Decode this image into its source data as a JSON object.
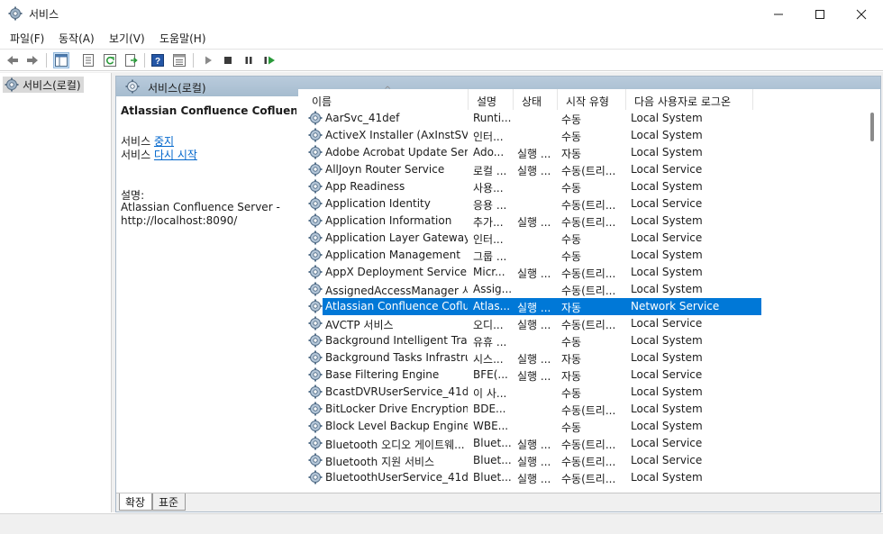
{
  "window": {
    "title": "서비스",
    "icon": "gear-icon"
  },
  "menu": [
    {
      "label": "파일(F)"
    },
    {
      "label": "동작(A)"
    },
    {
      "label": "보기(V)"
    },
    {
      "label": "도움말(H)"
    }
  ],
  "toolbar": {
    "buttons": [
      "back-icon",
      "forward-icon",
      "console-tree-icon",
      "properties-icon",
      "refresh-icon",
      "export-icon",
      "help-icon",
      "details-view-icon",
      "play-icon",
      "stop-icon",
      "pause-icon",
      "resume-icon"
    ]
  },
  "tree": {
    "item_label": "서비스(로컬)"
  },
  "pane": {
    "title": "서비스(로컬)"
  },
  "details": {
    "title": "Atlassian Confluence Cofluence",
    "action_prefix_1": "서비스 ",
    "stop_link": "중지",
    "action_prefix_2": "서비스 ",
    "restart_link": "다시 시작",
    "desc_label": "설명:",
    "desc_line1": "Atlassian Confluence Server -",
    "desc_line2": "http://localhost:8090/"
  },
  "columns": {
    "name": "이름",
    "description": "설명",
    "status": "상태",
    "startup": "시작 유형",
    "logon": "다음 사용자로 로그온"
  },
  "services": [
    {
      "name": "AarSvc_41def",
      "description": "Runti...",
      "status": "",
      "startup": "수동",
      "logon": "Local System"
    },
    {
      "name": "ActiveX Installer (AxInstSV)",
      "description": "인터...",
      "status": "",
      "startup": "수동",
      "logon": "Local System"
    },
    {
      "name": "Adobe Acrobat Update Ser...",
      "description": "Ado...",
      "status": "실행 ...",
      "startup": "자동",
      "logon": "Local System"
    },
    {
      "name": "AllJoyn Router Service",
      "description": "로컬 ...",
      "status": "실행 ...",
      "startup": "수동(트리...",
      "logon": "Local Service"
    },
    {
      "name": "App Readiness",
      "description": "사용...",
      "status": "",
      "startup": "수동",
      "logon": "Local System"
    },
    {
      "name": "Application Identity",
      "description": "응용 ...",
      "status": "",
      "startup": "수동(트리...",
      "logon": "Local Service"
    },
    {
      "name": "Application Information",
      "description": "추가...",
      "status": "실행 ...",
      "startup": "수동(트리...",
      "logon": "Local System"
    },
    {
      "name": "Application Layer Gateway ...",
      "description": "인터...",
      "status": "",
      "startup": "수동",
      "logon": "Local Service"
    },
    {
      "name": "Application Management",
      "description": "그룹 ...",
      "status": "",
      "startup": "수동",
      "logon": "Local System"
    },
    {
      "name": "AppX Deployment Service ...",
      "description": "Micr...",
      "status": "실행 ...",
      "startup": "수동(트리...",
      "logon": "Local System"
    },
    {
      "name": "AssignedAccessManager 서...",
      "description": "Assig...",
      "status": "",
      "startup": "수동(트리...",
      "logon": "Local System"
    },
    {
      "name": "Atlassian Confluence Coflu...",
      "description": "Atlas...",
      "status": "실행 ...",
      "startup": "자동",
      "logon": "Network Service",
      "selected": true
    },
    {
      "name": "AVCTP 서비스",
      "description": "오디...",
      "status": "실행 ...",
      "startup": "수동(트리...",
      "logon": "Local Service"
    },
    {
      "name": "Background Intelligent Tra...",
      "description": "유휴 ...",
      "status": "",
      "startup": "수동",
      "logon": "Local System"
    },
    {
      "name": "Background Tasks Infrastru...",
      "description": "시스...",
      "status": "실행 ...",
      "startup": "자동",
      "logon": "Local System"
    },
    {
      "name": "Base Filtering Engine",
      "description": "BFE(...",
      "status": "실행 ...",
      "startup": "자동",
      "logon": "Local Service"
    },
    {
      "name": "BcastDVRUserService_41def",
      "description": "이 사...",
      "status": "",
      "startup": "수동",
      "logon": "Local System"
    },
    {
      "name": "BitLocker Drive Encryption ...",
      "description": "BDE...",
      "status": "",
      "startup": "수동(트리...",
      "logon": "Local System"
    },
    {
      "name": "Block Level Backup Engine ...",
      "description": "WBE...",
      "status": "",
      "startup": "수동",
      "logon": "Local System"
    },
    {
      "name": "Bluetooth 오디오 게이트웨...",
      "description": "Bluet...",
      "status": "실행 ...",
      "startup": "수동(트리...",
      "logon": "Local Service"
    },
    {
      "name": "Bluetooth 지원 서비스",
      "description": "Bluet...",
      "status": "실행 ...",
      "startup": "수동(트리...",
      "logon": "Local Service"
    },
    {
      "name": "BluetoothUserService_41def",
      "description": "Bluet...",
      "status": "실행 ...",
      "startup": "수동(트리...",
      "logon": "Local System"
    }
  ],
  "tabs": [
    {
      "label": "확장"
    },
    {
      "label": "표준"
    }
  ]
}
